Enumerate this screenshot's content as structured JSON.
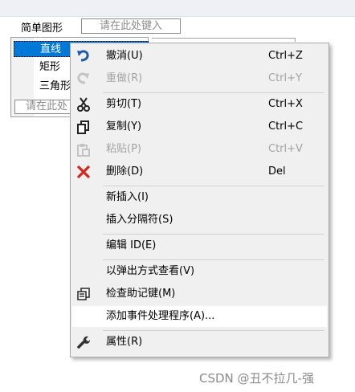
{
  "menubar": {
    "top_item": "简单图形",
    "type_here": "请在此处键入"
  },
  "dropdown": {
    "items": [
      "直线",
      "矩形",
      "三角形"
    ],
    "type_here": "请在此处"
  },
  "context_menu": {
    "items": [
      {
        "icon": "undo-icon",
        "label": "撤消(U)",
        "shortcut": "Ctrl+Z",
        "enabled": true
      },
      {
        "icon": "redo-icon",
        "label": "重做(R)",
        "shortcut": "Ctrl+Y",
        "enabled": false
      },
      {
        "icon": "cut-icon",
        "label": "剪切(T)",
        "shortcut": "Ctrl+X",
        "enabled": true
      },
      {
        "icon": "copy-icon",
        "label": "复制(Y)",
        "shortcut": "Ctrl+C",
        "enabled": true
      },
      {
        "icon": "paste-icon",
        "label": "粘贴(P)",
        "shortcut": "Ctrl+V",
        "enabled": false
      },
      {
        "icon": "delete-icon",
        "label": "删除(D)",
        "shortcut": "Del",
        "enabled": true
      },
      {
        "label": "新插入(I)",
        "enabled": true
      },
      {
        "label": "插入分隔符(S)",
        "enabled": true
      },
      {
        "label": "编辑 ID(E)",
        "enabled": true
      },
      {
        "label": "以弹出方式查看(V)",
        "enabled": true
      },
      {
        "icon": "mnemonic-icon",
        "label": "检查助记键(M)",
        "enabled": true
      },
      {
        "label": "添加事件处理程序(A)...",
        "enabled": true,
        "hover": true
      },
      {
        "icon": "wrench-icon",
        "label": "属性(R)",
        "enabled": true
      }
    ]
  },
  "colors": {
    "selection": "#0078d7",
    "delete_red": "#d6281e",
    "undo_blue": "#1e5aa8"
  },
  "watermark": "CSDN @丑不拉几-强"
}
